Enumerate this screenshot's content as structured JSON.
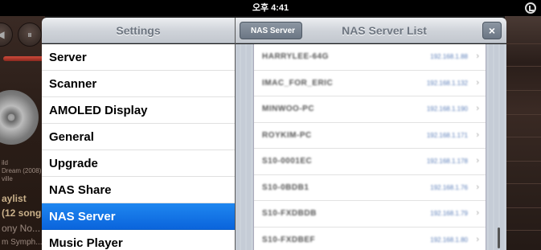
{
  "statusbar": {
    "time": "오후 4:41",
    "icon": "orientation-lock-icon"
  },
  "background_app": {
    "left_texts": [
      "ild",
      "Dream (2008)",
      "ville"
    ],
    "playlist_label": "aylist",
    "songs_label": "(12 song",
    "track_label": "ony No...",
    "artist_label": "m Symph..."
  },
  "settings": {
    "title": "Settings",
    "items": [
      {
        "label": "Server",
        "selected": false
      },
      {
        "label": "Scanner",
        "selected": false
      },
      {
        "label": "AMOLED Display",
        "selected": false
      },
      {
        "label": "General",
        "selected": false
      },
      {
        "label": "Upgrade",
        "selected": false
      },
      {
        "label": "NAS Share",
        "selected": false
      },
      {
        "label": "NAS Server",
        "selected": true
      },
      {
        "label": "Music Player",
        "selected": false
      }
    ]
  },
  "nas_panel": {
    "back_label": "NAS Server",
    "title": "NAS Server List",
    "close_label": "×",
    "rows": [
      {
        "name": "HARRYLEE-64G",
        "ip": "192.168.1.88"
      },
      {
        "name": "IMAC_FOR_ERIC",
        "ip": "192.168.1.132"
      },
      {
        "name": "MINWOO-PC",
        "ip": "192.168.1.190"
      },
      {
        "name": "ROYKIM-PC",
        "ip": "192.168.1.171"
      },
      {
        "name": "S10-0001EC",
        "ip": "192.168.1.178"
      },
      {
        "name": "S10-0BDB1",
        "ip": "192.168.1.76"
      },
      {
        "name": "S10-FXDBDB",
        "ip": "192.168.1.79"
      },
      {
        "name": "S10-FXDBEF",
        "ip": "192.168.1.80"
      }
    ]
  }
}
